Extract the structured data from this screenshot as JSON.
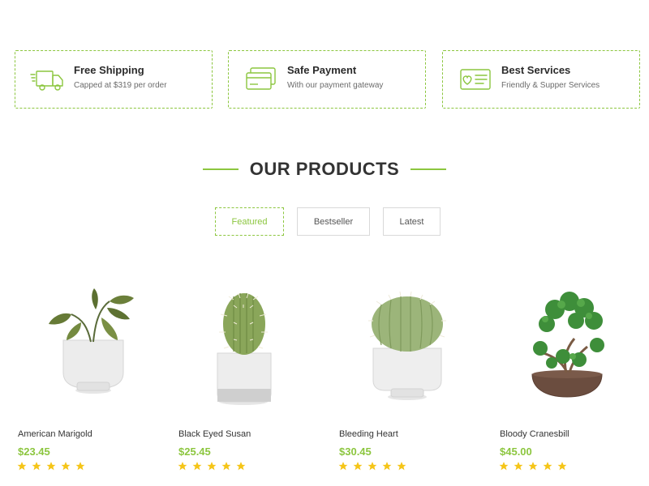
{
  "colors": {
    "accent": "#8cc63f",
    "star": "#f5c518",
    "text": "#333333"
  },
  "features": [
    {
      "icon": "truck-icon",
      "title": "Free Shipping",
      "subtitle": "Capped at $319 per order"
    },
    {
      "icon": "credit-card-icon",
      "title": "Safe Payment",
      "subtitle": "With our payment gateway"
    },
    {
      "icon": "service-card-icon",
      "title": "Best Services",
      "subtitle": "Friendly & Supper Services"
    }
  ],
  "section": {
    "title": "OUR PRODUCTS"
  },
  "tabs": [
    {
      "label": "Featured",
      "active": true
    },
    {
      "label": "Bestseller",
      "active": false
    },
    {
      "label": "Latest",
      "active": false
    }
  ],
  "products": [
    {
      "name": "American Marigold",
      "price": "$23.45",
      "rating": 5,
      "image": "potted-leafy-plant"
    },
    {
      "name": "Black Eyed Susan",
      "price": "$25.45",
      "rating": 5,
      "image": "potted-tall-cactus"
    },
    {
      "name": "Bleeding Heart",
      "price": "$30.45",
      "rating": 5,
      "image": "potted-round-cactus"
    },
    {
      "name": "Bloody Cranesbill",
      "price": "$45.00",
      "rating": 5,
      "image": "bonsai-tree"
    }
  ]
}
